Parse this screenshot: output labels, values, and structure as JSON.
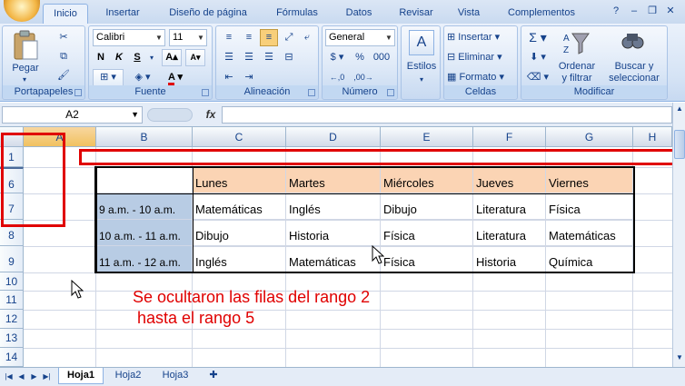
{
  "tabs": [
    {
      "label": "Inicio",
      "active": true
    },
    {
      "label": "Insertar"
    },
    {
      "label": "Diseño de página"
    },
    {
      "label": "Fórmulas"
    },
    {
      "label": "Datos"
    },
    {
      "label": "Revisar"
    },
    {
      "label": "Vista"
    },
    {
      "label": "Complementos"
    }
  ],
  "ribbon": {
    "portapapeles": {
      "label": "Portapapeles",
      "pegar": "Pegar"
    },
    "fuente": {
      "label": "Fuente",
      "font": "Calibri",
      "size": "11",
      "bold": "N",
      "italic": "K",
      "underline": "S"
    },
    "alineacion": {
      "label": "Alineación"
    },
    "numero": {
      "label": "Número",
      "format": "General",
      "percent": "%",
      "thousands": "000"
    },
    "estilos": {
      "label": "Estilos"
    },
    "celdas": {
      "label": "Celdas",
      "insertar": "Insertar",
      "eliminar": "Eliminar",
      "formato": "Formato"
    },
    "modificar": {
      "label": "Modificar",
      "ordenar": "Ordenar\ny filtrar",
      "buscar": "Buscar y\nseleccionar"
    }
  },
  "formula_bar": {
    "name_box": "A2",
    "fx": "fx",
    "value": ""
  },
  "columns": [
    "A",
    "B",
    "C",
    "D",
    "E",
    "F",
    "G",
    "H"
  ],
  "rows": [
    "1",
    "6",
    "7",
    "8",
    "9",
    "10",
    "11",
    "12",
    "13",
    "14"
  ],
  "table": {
    "headers": [
      "Lunes",
      "Martes",
      "Miércoles",
      "Jueves",
      "Viernes"
    ],
    "rows": [
      {
        "time": "9 a.m. - 10 a.m.",
        "cells": [
          "Matemáticas",
          "Inglés",
          "Dibujo",
          "Literatura",
          "Física"
        ]
      },
      {
        "time": "10 a.m. - 11 a.m.",
        "cells": [
          "Dibujo",
          "Historia",
          "Física",
          "Literatura",
          "Matemáticas"
        ]
      },
      {
        "time": "11 a.m. - 12 a.m.",
        "cells": [
          "Inglés",
          "Matemáticas",
          "Física",
          "Historia",
          "Química"
        ]
      }
    ]
  },
  "annotation": {
    "line1": "Se ocultaron las filas del rango 2",
    "line2": " hasta el rango 5"
  },
  "sheets": [
    {
      "label": "Hoja1",
      "active": true
    },
    {
      "label": "Hoja2"
    },
    {
      "label": "Hoja3"
    }
  ],
  "colors": {
    "annotation": "#e00000",
    "header_fill": "#fbd4b4",
    "time_fill": "#b8cce4"
  }
}
